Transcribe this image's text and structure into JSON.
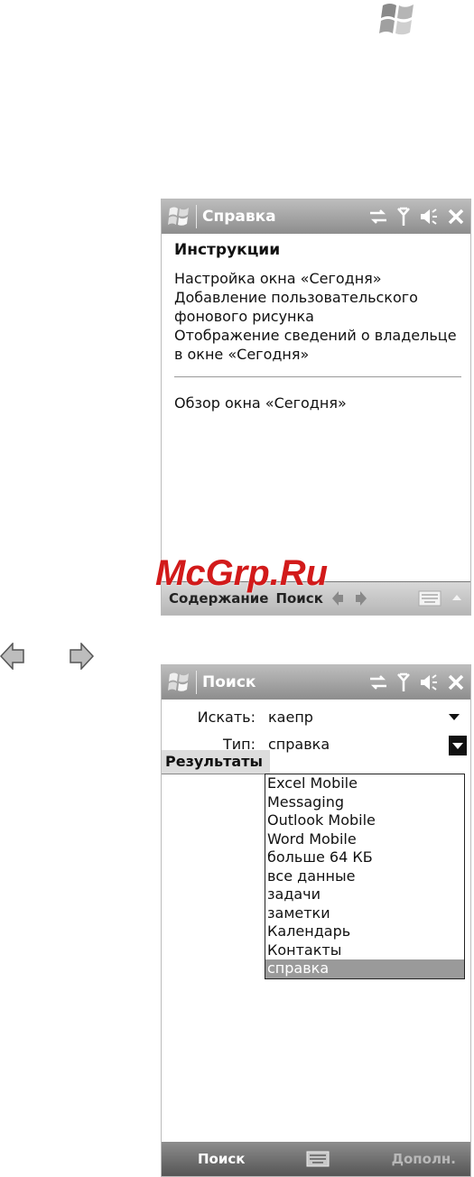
{
  "top_logo": {
    "icon": "windows-flag-icon"
  },
  "screen1": {
    "title": "Справка",
    "heading": "Инструкции",
    "links": [
      "Настройка окна «Сегодня»",
      "Добавление пользовательского фонового рисунка",
      "Отображение сведений о владельце в окне «Сегодня»"
    ],
    "overview_link": "Обзор окна «Сегодня»",
    "bottom": {
      "contents": "Содержание",
      "search": "Поиск"
    }
  },
  "watermark": "McGrp.Ru",
  "screen2": {
    "title": "Поиск",
    "search_label": "Искать:",
    "search_value": "каепр",
    "type_label": "Тип:",
    "type_value": "справка",
    "results_header": "Результаты",
    "type_options": [
      "Excel Mobile",
      "Messaging",
      "Outlook Mobile",
      "Word Mobile",
      "больше 64 КБ",
      "все данные",
      "задачи",
      "заметки",
      "Календарь",
      "Контакты",
      "справка"
    ],
    "selected_option": "справка",
    "bottom": {
      "left": "Поиск",
      "right": "Дополн."
    }
  }
}
